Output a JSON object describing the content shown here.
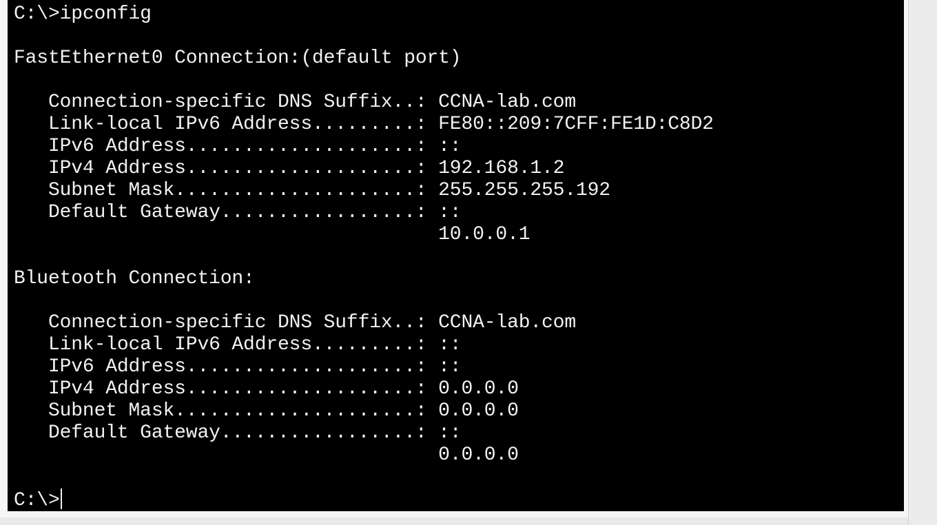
{
  "terminal": {
    "lines": [
      "C:\\>ipconfig",
      "",
      "FastEthernet0 Connection:(default port)",
      "",
      "   Connection-specific DNS Suffix..: CCNA-lab.com",
      "   Link-local IPv6 Address.........: FE80::209:7CFF:FE1D:C8D2",
      "   IPv6 Address....................: ::",
      "   IPv4 Address....................: 192.168.1.2",
      "   Subnet Mask.....................: 255.255.255.192",
      "   Default Gateway.................: ::",
      "                                     10.0.0.1",
      "",
      "Bluetooth Connection:",
      "",
      "   Connection-specific DNS Suffix..: CCNA-lab.com",
      "   Link-local IPv6 Address.........: ::",
      "   IPv6 Address....................: ::",
      "   IPv4 Address....................: 0.0.0.0",
      "   Subnet Mask.....................: 0.0.0.0",
      "   Default Gateway.................: ::",
      "                                     0.0.0.0",
      ""
    ],
    "prompt": "C:\\>"
  },
  "colors": {
    "terminal_background": "#000000",
    "terminal_text": "#f2f2f2",
    "window_background": "#ececec"
  }
}
